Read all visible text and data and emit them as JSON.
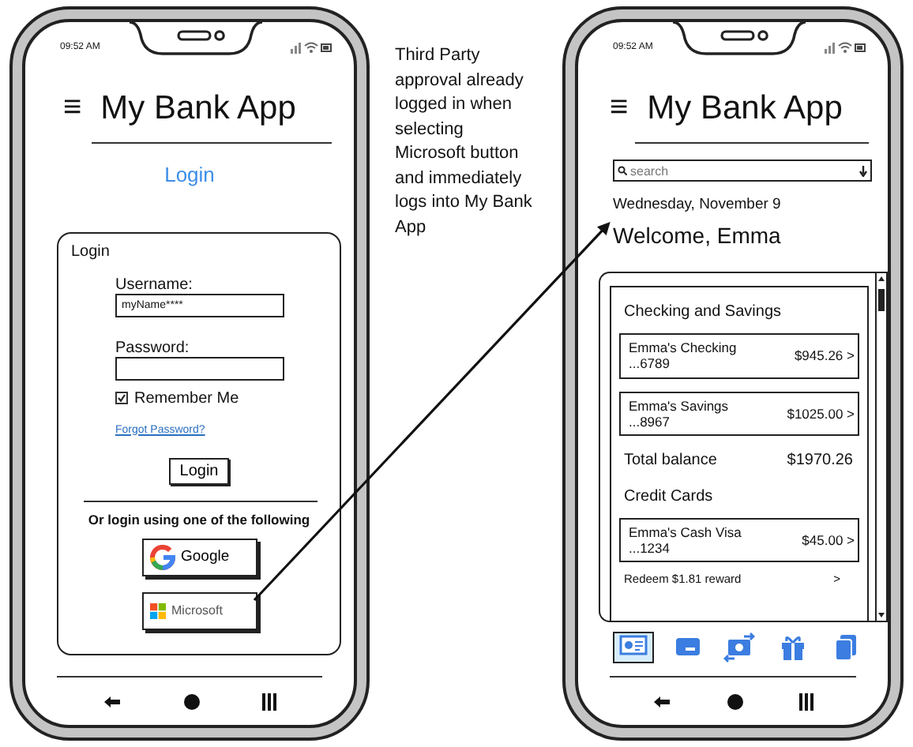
{
  "login_phone": {
    "status_time": "09:52 AM",
    "header": {
      "menu_glyph": "≡",
      "title": "My Bank App"
    },
    "login_link": "Login",
    "form": {
      "title": "Login",
      "fields": [
        {
          "label": "Username:",
          "value": "myName****"
        },
        {
          "label": "Password:"
        }
      ],
      "remember": {
        "label": "Remember Me",
        "checked": true
      },
      "forgot_link": "Forgot Password?",
      "submit": "Login",
      "divider_text": "Or login using one of the following",
      "providers": [
        {
          "kind": "google",
          "label": "Google"
        },
        {
          "kind": "microsoft",
          "label": "Microsoft"
        }
      ]
    }
  },
  "annotation": "Third Party approval already logged in when selecting Microsoft button and immediately logs into My Bank App",
  "home_phone": {
    "status_time": "09:52 AM",
    "header": {
      "menu_glyph": "≡",
      "title": "My Bank App"
    },
    "search": {
      "placeholder": "search"
    },
    "date": "Wednesday, November 9",
    "welcome": "Welcome, Emma",
    "sections": [
      {
        "title": "Checking and Savings",
        "accounts": [
          {
            "name": "Emma's Checking",
            "number": "...6789",
            "amount": "$945.26 >"
          },
          {
            "name": "Emma's Savings",
            "number": "...8967",
            "amount": "$1025.00 >"
          }
        ],
        "total": {
          "label": "Total balance",
          "amount": "$1970.26"
        }
      },
      {
        "title": "Credit Cards",
        "accounts": [
          {
            "name": "Emma's Cash Visa",
            "number": "...1234",
            "amount": "$45.00 >"
          }
        ],
        "reward": {
          "label": "Redeem $1.81 reward",
          "chevron": ">"
        }
      }
    ],
    "tabs": [
      {
        "kind": "accounts",
        "selected": true
      },
      {
        "kind": "card",
        "selected": false
      },
      {
        "kind": "transfer",
        "selected": false
      },
      {
        "kind": "gift",
        "selected": false
      },
      {
        "kind": "documents",
        "selected": false
      }
    ]
  }
}
